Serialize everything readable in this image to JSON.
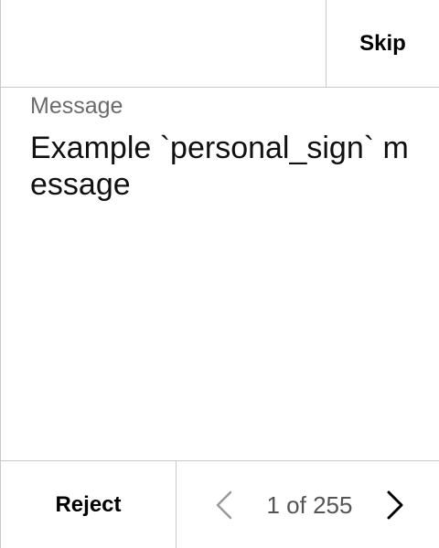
{
  "header": {
    "skip_label": "Skip"
  },
  "message": {
    "label": "Message",
    "body": "Example `personal_sign` message"
  },
  "footer": {
    "reject_label": "Reject",
    "page_indicator": "1 of 255",
    "prev_icon": "chevron-left-icon",
    "next_icon": "chevron-right-icon"
  },
  "colors": {
    "border": "#c9c9c9",
    "label_gray": "#6b6b6b",
    "disabled_icon": "#9a9a9a",
    "active_icon": "#000000"
  }
}
